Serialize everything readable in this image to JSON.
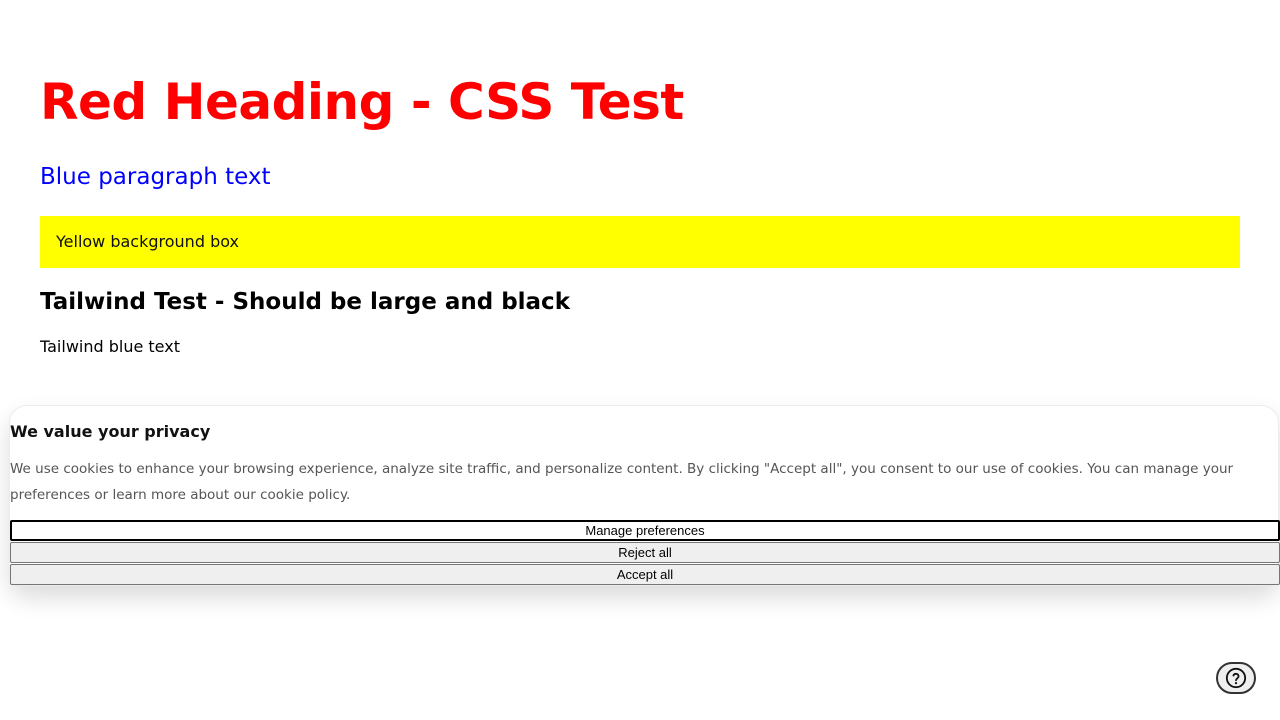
{
  "content": {
    "red_heading": "Red Heading - CSS Test",
    "blue_paragraph": "Blue paragraph text",
    "yellow_box": "Yellow background box",
    "tailwind_heading": "Tailwind Test - Should be large and black",
    "tailwind_blue_text": "Tailwind blue text"
  },
  "cookie_banner": {
    "title": "We value your privacy",
    "description": "We use cookies to enhance your browsing experience, analyze site traffic, and personalize content. By clicking \"Accept all\", you consent to our use of cookies. You can manage your preferences or learn more about our cookie policy.",
    "buttons": {
      "manage": "Manage preferences",
      "reject": "Reject all",
      "accept": "Accept all"
    }
  },
  "help": {
    "icon": "help-circle-icon"
  },
  "colors": {
    "red": "#ff0000",
    "blue": "#0000ff",
    "yellow": "#ffff00"
  }
}
